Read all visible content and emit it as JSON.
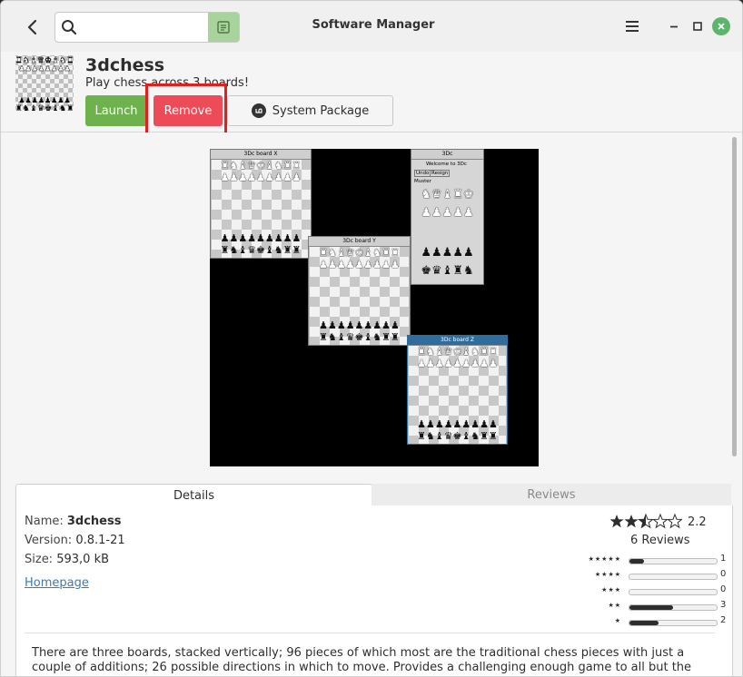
{
  "window": {
    "title": "Software Manager",
    "search_placeholder": ""
  },
  "app": {
    "name": "3dchess",
    "summary": "Play chess across 3 boards!",
    "launch_label": "Launch",
    "remove_label": "Remove",
    "system_package_label": "System Package"
  },
  "screenshot": {
    "board_x_title": "3Dc board X",
    "board_y_title": "3Dc board Y",
    "board_z_title": "3Dc board Z",
    "info_title": "3Dc",
    "info_welcome": "Welcome to 3Dc",
    "info_undo": "Undo",
    "info_resign": "Resign",
    "info_muster": "Muster"
  },
  "tabs": {
    "details": "Details",
    "reviews": "Reviews"
  },
  "details": {
    "name_label": "Name:",
    "name_value": "3dchess",
    "version_label": "Version:",
    "version_value": "0.8.1-21",
    "size_label": "Size:",
    "size_value": "593,0 kB",
    "homepage_label": "Homepage",
    "description": "There are three boards, stacked vertically; 96 pieces of which most are the traditional chess pieces with just a couple of additions; 26 possible directions in which to move. Provides a challenging enough game to all but the most highly skilled"
  },
  "rating": {
    "average": "2.2",
    "reviews_text": "6 Reviews",
    "breakdown": [
      {
        "stars": "★★★★★",
        "count": "1",
        "fraction": 0.17
      },
      {
        "stars": "★★★★",
        "count": "0",
        "fraction": 0
      },
      {
        "stars": "★★★",
        "count": "0",
        "fraction": 0
      },
      {
        "stars": "★★",
        "count": "3",
        "fraction": 0.5
      },
      {
        "stars": "★",
        "count": "2",
        "fraction": 0.33
      }
    ]
  },
  "colors": {
    "launch": "#6db24d",
    "remove": "#ee4b59",
    "highlight": "#e41d1d",
    "link": "#3a7ab8"
  }
}
